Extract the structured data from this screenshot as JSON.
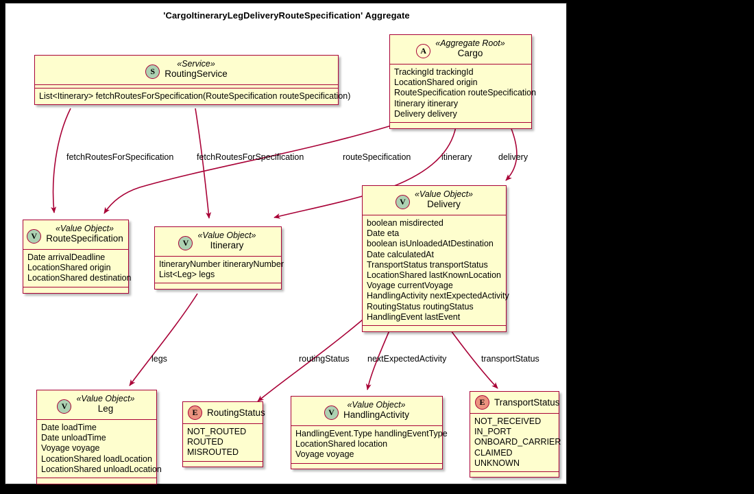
{
  "diagram": {
    "title": "'CargoItineraryLegDeliveryRouteSpecification' Aggregate",
    "accent_border": "#A80036",
    "box_fill": "#FEFECE",
    "badge_green": "#ADD1B2",
    "badge_salmon": "#EB937F",
    "canvas_bg": "#000000",
    "frame_bg": "#FFFFFF"
  },
  "classes": {
    "routing_service": {
      "badge": "S",
      "stereotype": "«Service»",
      "name": "RoutingService",
      "attributes": [],
      "operations": [
        "List<Itinerary> fetchRoutesForSpecification(RouteSpecification routeSpecification)"
      ]
    },
    "cargo": {
      "badge": "A",
      "stereotype": "«Aggregate Root»",
      "name": "Cargo",
      "attributes": [
        "TrackingId trackingId",
        "LocationShared origin",
        "RouteSpecification routeSpecification",
        "Itinerary itinerary",
        "Delivery delivery"
      ]
    },
    "route_specification": {
      "badge": "V",
      "stereotype": "«Value Object»",
      "name": "RouteSpecification",
      "attributes": [
        "Date arrivalDeadline",
        "LocationShared origin",
        "LocationShared destination"
      ]
    },
    "itinerary": {
      "badge": "V",
      "stereotype": "«Value Object»",
      "name": "Itinerary",
      "attributes": [
        "ItineraryNumber itineraryNumber",
        "List<Leg> legs"
      ]
    },
    "delivery": {
      "badge": "V",
      "stereotype": "«Value Object»",
      "name": "Delivery",
      "attributes": [
        "boolean misdirected",
        "Date eta",
        "boolean isUnloadedAtDestination",
        "Date calculatedAt",
        "TransportStatus transportStatus",
        "LocationShared lastKnownLocation",
        "Voyage currentVoyage",
        "HandlingActivity nextExpectedActivity",
        "RoutingStatus routingStatus",
        "HandlingEvent lastEvent"
      ]
    },
    "leg": {
      "badge": "V",
      "stereotype": "«Value Object»",
      "name": "Leg",
      "attributes": [
        "Date loadTime",
        "Date unloadTime",
        "Voyage voyage",
        "LocationShared loadLocation",
        "LocationShared unloadLocation"
      ]
    },
    "routing_status": {
      "badge": "E",
      "stereotype": "",
      "name": "RoutingStatus",
      "attributes": [
        "NOT_ROUTED",
        "ROUTED",
        "MISROUTED"
      ]
    },
    "handling_activity": {
      "badge": "V",
      "stereotype": "«Value Object»",
      "name": "HandlingActivity",
      "attributes": [
        "HandlingEvent.Type handlingEventType",
        "LocationShared location",
        "Voyage voyage"
      ]
    },
    "transport_status": {
      "badge": "E",
      "stereotype": "",
      "name": "TransportStatus",
      "attributes": [
        "NOT_RECEIVED",
        "IN_PORT",
        "ONBOARD_CARRIER",
        "CLAIMED",
        "UNKNOWN"
      ]
    }
  },
  "edges": [
    {
      "id": "e1",
      "label": "fetchRoutesForSpecification",
      "from": "routing_service",
      "to": "route_specification"
    },
    {
      "id": "e2",
      "label": "fetchRoutesForSpecification",
      "from": "routing_service",
      "to": "itinerary"
    },
    {
      "id": "e3",
      "label": "routeSpecification",
      "from": "cargo",
      "to": "route_specification"
    },
    {
      "id": "e4",
      "label": "itinerary",
      "from": "cargo",
      "to": "itinerary"
    },
    {
      "id": "e5",
      "label": "delivery",
      "from": "cargo",
      "to": "delivery"
    },
    {
      "id": "e6",
      "label": "legs",
      "from": "itinerary",
      "to": "leg"
    },
    {
      "id": "e7",
      "label": "routingStatus",
      "from": "delivery",
      "to": "routing_status"
    },
    {
      "id": "e8",
      "label": "nextExpectedActivity",
      "from": "delivery",
      "to": "handling_activity"
    },
    {
      "id": "e9",
      "label": "transportStatus",
      "from": "delivery",
      "to": "transport_status"
    }
  ]
}
